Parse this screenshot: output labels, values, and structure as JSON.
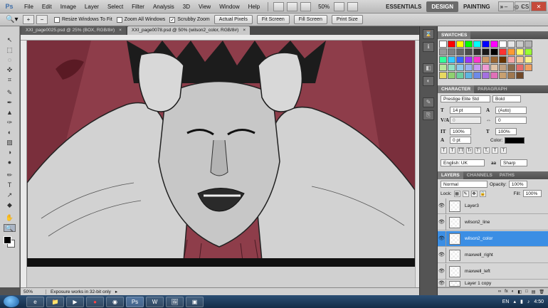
{
  "app": {
    "logo": "Ps"
  },
  "menu": [
    "File",
    "Edit",
    "Image",
    "Layer",
    "Select",
    "Filter",
    "Analysis",
    "3D",
    "View",
    "Window",
    "Help"
  ],
  "menubar": {
    "zoom": "50%",
    "workspaces": [
      "ESSENTIALS",
      "DESIGN",
      "PAINTING"
    ],
    "more": "»",
    "cslive": "CS Live"
  },
  "options": {
    "checkboxes": [
      {
        "label": "Resize Windows To Fit",
        "checked": false
      },
      {
        "label": "Zoom All Windows",
        "checked": false
      },
      {
        "label": "Scrubby Zoom",
        "checked": true
      }
    ],
    "buttons": [
      "Actual Pixels",
      "Fit Screen",
      "Fill Screen",
      "Print Size"
    ]
  },
  "tabs": [
    {
      "label": "XXI_page0025.psd @ 25% (BOX, RGB/8#)",
      "close": "×",
      "active": false
    },
    {
      "label": "XXI_page0078.psd @ 50% (wilson2_color, RGB/8#)",
      "close": "×",
      "active": true
    }
  ],
  "tools": [
    "↖",
    "⬚",
    "◌",
    "✜",
    "⌗",
    "✎",
    "✒",
    "▲",
    "✑",
    "◐",
    "▨",
    "◑",
    "●",
    "✏",
    "T",
    "↗",
    "◆",
    "✋",
    "🔍"
  ],
  "statusbar": {
    "zoom": "50%",
    "message": "Exposure works in 32-bit only"
  },
  "swatches": {
    "title": "SWATCHES",
    "colors": [
      "#ffffff",
      "#ff0000",
      "#ffff00",
      "#00ff00",
      "#00ffff",
      "#0000ff",
      "#ff00ff",
      "#ffffff",
      "#e6e6e6",
      "#cccccc",
      "#b3b3b3",
      "#999999",
      "#808080",
      "#666666",
      "#4d4d4d",
      "#333333",
      "#1a1a1a",
      "#000000",
      "#ff3333",
      "#ff9933",
      "#ffff66",
      "#99ff33",
      "#33ff99",
      "#33ccff",
      "#3366ff",
      "#9933ff",
      "#ff33cc",
      "#cc9966",
      "#996633",
      "#663300",
      "#f4a6a6",
      "#f6c59a",
      "#faf08c",
      "#b8e59a",
      "#8fe0c4",
      "#8ec8ec",
      "#9ab0f0",
      "#c69af0",
      "#ef9ad4",
      "#e0c4a8",
      "#c0a080",
      "#8a6a4a",
      "#e66b6b",
      "#f0a060",
      "#e8d860",
      "#8fd070",
      "#6ccfa0",
      "#5fb4e0",
      "#6e8ae8",
      "#a470e0",
      "#e070b8",
      "#c8a070",
      "#a07850",
      "#704828"
    ]
  },
  "character": {
    "tabs": [
      "CHARACTER",
      "PARAGRAPH"
    ],
    "font_family": "Prestige Elite Std",
    "font_style": "Bold",
    "size": "14 pt",
    "leading": "(Auto)",
    "kerning_label": "V/A",
    "kerning": "0",
    "tracking": "0",
    "vert_scale": "100%",
    "horiz_scale": "100%",
    "baseline": "0 pt",
    "color_label": "Color:",
    "language": "English: UK",
    "antialias": "Sharp",
    "style_buttons": [
      "T",
      "T",
      "TT",
      "Tr",
      "T'",
      "T,",
      "T",
      "T"
    ]
  },
  "layers": {
    "tabs": [
      "LAYERS",
      "CHANNELS",
      "PATHS"
    ],
    "blend_mode": "Normal",
    "opacity_label": "Opacity:",
    "opacity": "100%",
    "lock_label": "Lock:",
    "fill_label": "Fill:",
    "fill": "100%",
    "items": [
      {
        "name": "Layer3",
        "selected": false
      },
      {
        "name": "wilson2_line",
        "selected": false
      },
      {
        "name": "wilson2_color",
        "selected": true
      },
      {
        "name": "maxwell_right",
        "selected": false
      },
      {
        "name": "maxwell_left",
        "selected": false
      },
      {
        "name": "Layer 1 copy",
        "selected": false
      }
    ],
    "footer_icons": [
      "∞",
      "fx",
      "◐",
      "◧",
      "□",
      "▤",
      "🗑"
    ]
  },
  "taskbar": {
    "apps": [
      "e",
      "📁",
      "▶",
      "●",
      "◉",
      "Ps",
      "W",
      "🖼",
      "▣"
    ],
    "active_index": 5,
    "language": "EN",
    "time": "4:50"
  }
}
